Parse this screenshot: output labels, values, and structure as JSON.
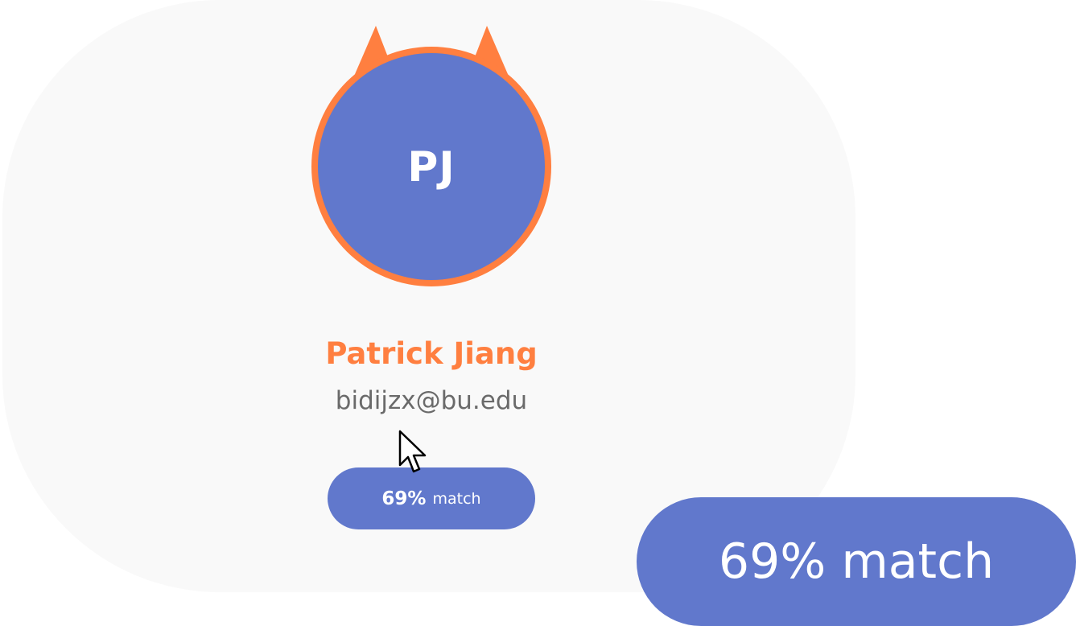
{
  "profile": {
    "initials": "PJ",
    "name": "Patrick Jiang",
    "email": "bidijzx@bu.edu",
    "avatar_bg_color": "#6178cc",
    "avatar_ring_color": "#ff7f40",
    "avatar_icon": "cat-ears-avatar-icon"
  },
  "match": {
    "percent": "69%",
    "label": "match",
    "full_label": "69% match",
    "color": "#6178cc"
  },
  "theme": {
    "accent": "#ff7f40",
    "primary": "#6178cc",
    "card_bg": "#f9f9f9"
  },
  "cursor": {
    "icon": "mouse-pointer-icon"
  }
}
